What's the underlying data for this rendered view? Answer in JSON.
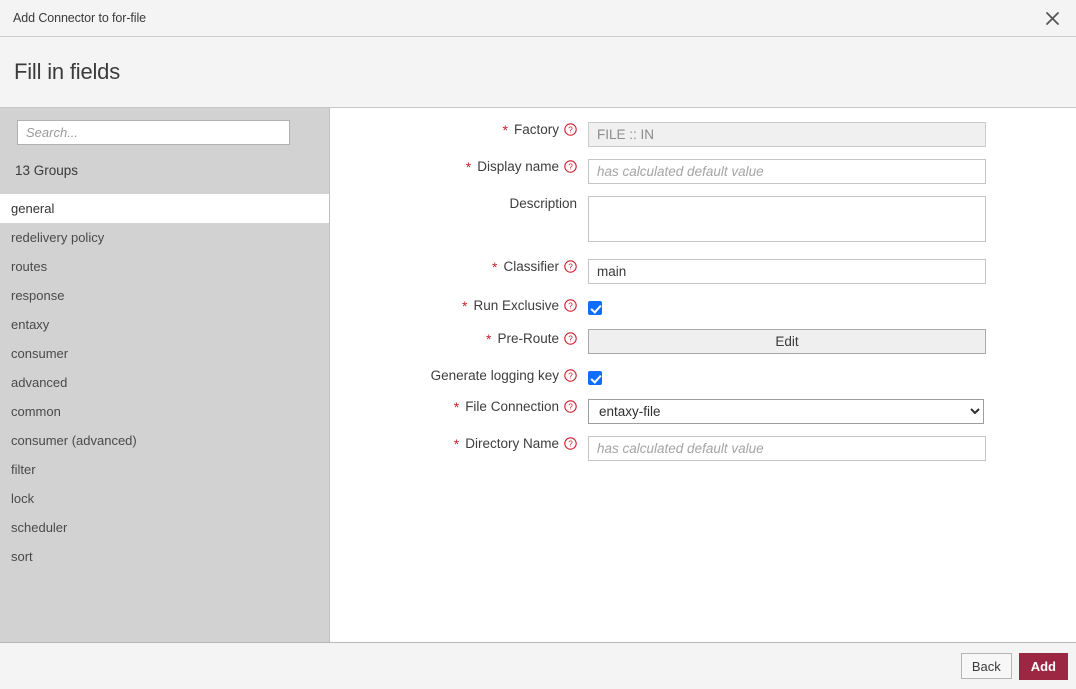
{
  "window": {
    "title": "Add Connector to for-file",
    "close_icon": "close-icon"
  },
  "header": {
    "title": "Fill in fields"
  },
  "sidebar": {
    "search": {
      "placeholder": "Search...",
      "value": ""
    },
    "groups_count_label": "13 Groups",
    "items": [
      {
        "label": "general",
        "active": true
      },
      {
        "label": "redelivery policy",
        "active": false
      },
      {
        "label": "routes",
        "active": false
      },
      {
        "label": "response",
        "active": false
      },
      {
        "label": "entaxy",
        "active": false
      },
      {
        "label": "consumer",
        "active": false
      },
      {
        "label": "advanced",
        "active": false
      },
      {
        "label": "common",
        "active": false
      },
      {
        "label": "consumer (advanced)",
        "active": false
      },
      {
        "label": "filter",
        "active": false
      },
      {
        "label": "lock",
        "active": false
      },
      {
        "label": "scheduler",
        "active": false
      },
      {
        "label": "sort",
        "active": false
      }
    ]
  },
  "form": {
    "fields": [
      {
        "name": "factory",
        "label": "Factory",
        "required": true,
        "help": true,
        "type": "text",
        "value": "FILE :: IN",
        "placeholder": "",
        "disabled": true
      },
      {
        "name": "display-name",
        "label": "Display name",
        "required": true,
        "help": true,
        "type": "text",
        "value": "",
        "placeholder": "has calculated default value",
        "disabled": false
      },
      {
        "name": "description",
        "label": "Description",
        "required": false,
        "help": false,
        "type": "textarea",
        "value": "",
        "placeholder": "",
        "disabled": false
      },
      {
        "name": "classifier",
        "label": "Classifier",
        "required": true,
        "help": true,
        "type": "text",
        "value": "main",
        "placeholder": "",
        "disabled": false
      },
      {
        "name": "run-exclusive",
        "label": "Run Exclusive",
        "required": true,
        "help": true,
        "type": "checkbox",
        "checked": true
      },
      {
        "name": "pre-route",
        "label": "Pre-Route",
        "required": true,
        "help": true,
        "type": "button",
        "button_label": "Edit"
      },
      {
        "name": "generate-logging-key",
        "label": "Generate logging key",
        "required": false,
        "help": true,
        "type": "checkbox",
        "checked": true
      },
      {
        "name": "file-connection",
        "label": "File Connection",
        "required": true,
        "help": true,
        "type": "select",
        "value": "entaxy-file",
        "options": [
          "entaxy-file"
        ]
      },
      {
        "name": "directory-name",
        "label": "Directory Name",
        "required": true,
        "help": true,
        "type": "text",
        "value": "",
        "placeholder": "has calculated default value",
        "disabled": false
      }
    ],
    "required_marker": "*",
    "help_icon": "help-circle-icon"
  },
  "footer": {
    "back_label": "Back",
    "add_label": "Add"
  },
  "colors": {
    "accent_red": "#9c2742",
    "required_star": "#cf2030",
    "checkbox_blue": "#0d6efd",
    "sidebar_bg": "#d2d2d2",
    "header_bg": "#f4f4f4"
  }
}
